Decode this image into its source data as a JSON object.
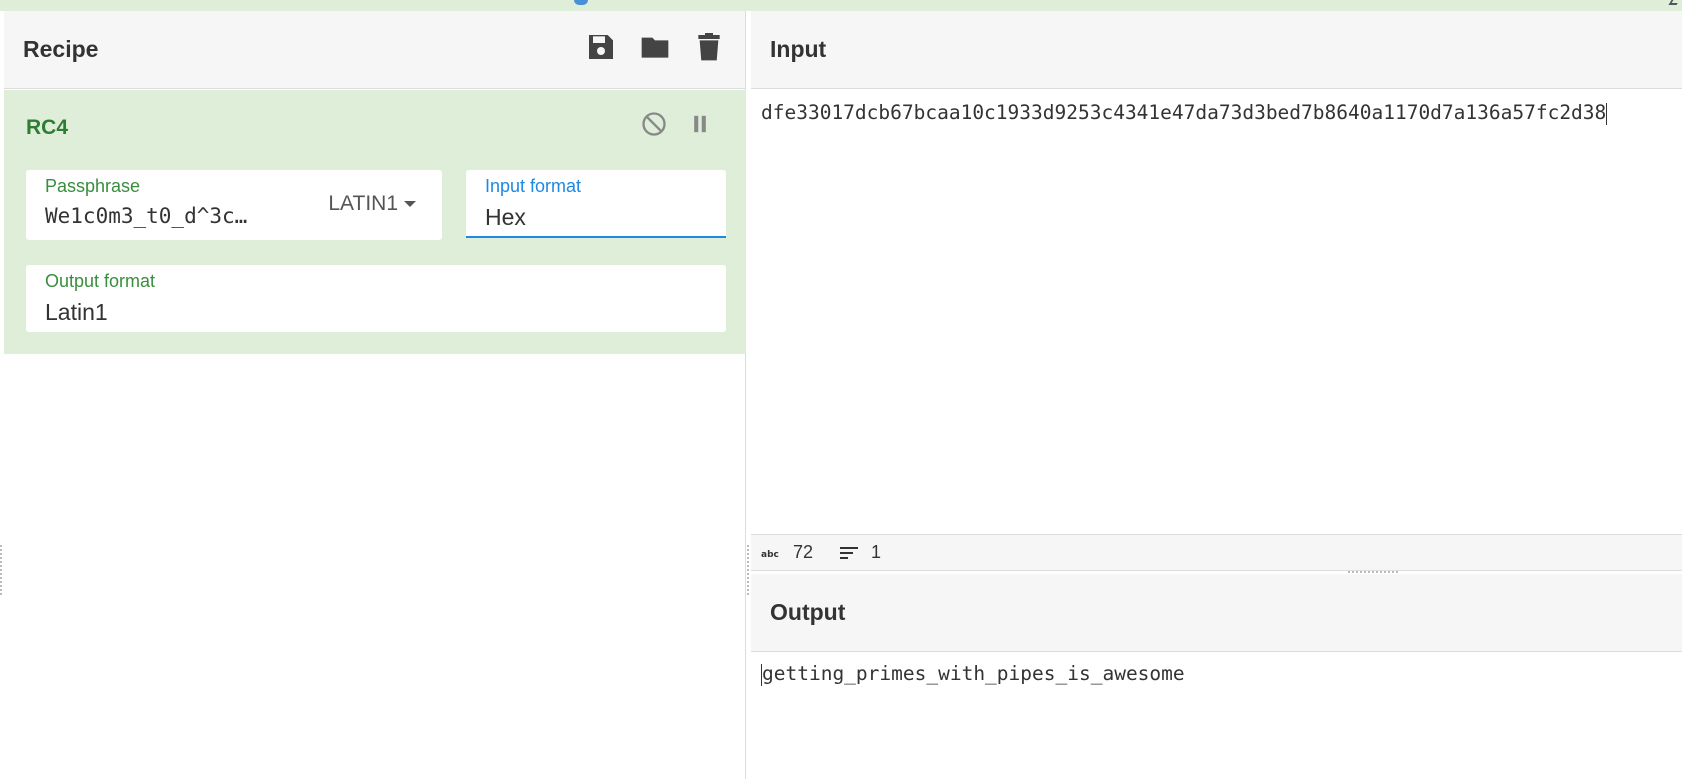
{
  "recipe": {
    "title": "Recipe",
    "icons": [
      "save-icon",
      "folder-icon",
      "trash-icon"
    ]
  },
  "operation": {
    "name": "RC4",
    "controls": [
      "disable-icon",
      "pause-icon"
    ],
    "passphrase": {
      "label": "Passphrase",
      "value": "We1c0m3_t0_d^3c…",
      "encoding": "LATIN1"
    },
    "input_format": {
      "label": "Input format",
      "value": "Hex"
    },
    "output_format": {
      "label": "Output format",
      "value": "Latin1"
    }
  },
  "input": {
    "title": "Input",
    "text": "dfe33017dcb67bcaa10c1933d9253c4341e47da73d3bed7b8640a1170d7a136a57fc2d38",
    "length": "72",
    "lines": "1"
  },
  "output": {
    "title": "Output",
    "text": "getting_primes_with_pipes_is_awesome"
  },
  "colors": {
    "operation_bg": "#dfeed9",
    "operation_title": "#2e7d32",
    "active_field": "#1e88e5"
  }
}
